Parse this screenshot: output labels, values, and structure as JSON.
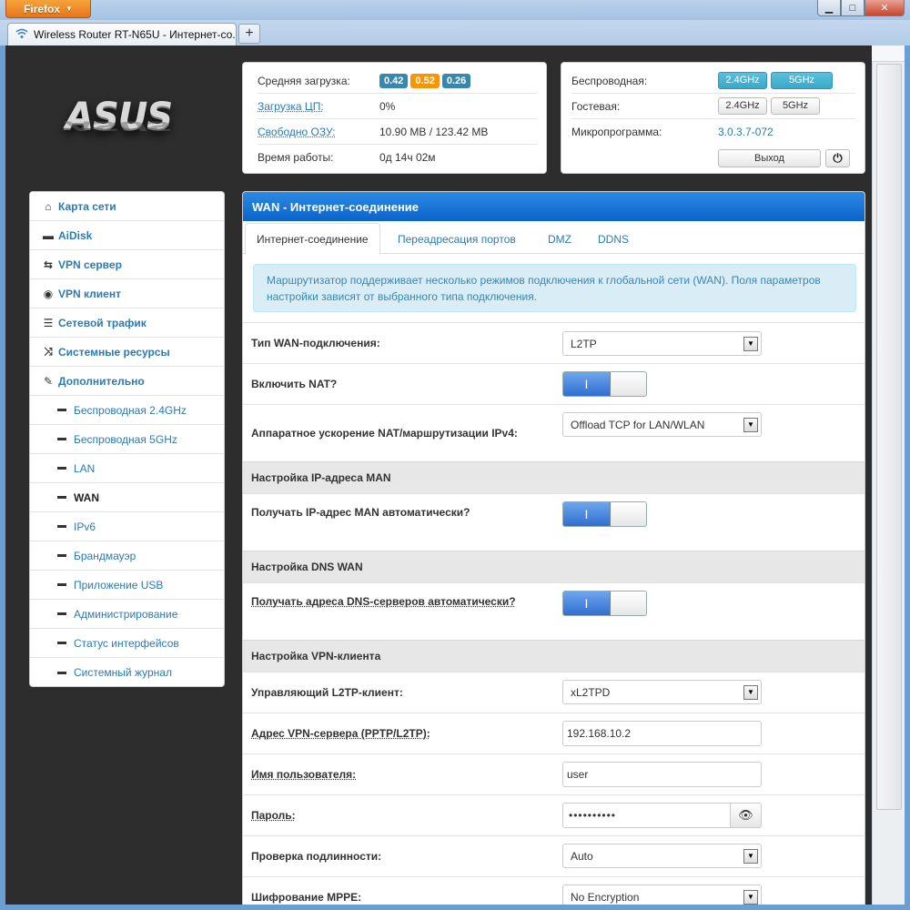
{
  "browser": {
    "app_button": "Firefox",
    "app_button_arrow": "▼",
    "tab_title": "Wireless Router RT-N65U - Интернет-со...",
    "new_tab": "+",
    "minimize": "▁",
    "maximize": "□",
    "close": "✕"
  },
  "logo": {
    "text": "ASUS"
  },
  "status": {
    "load_label": "Средняя загрузка:",
    "load_values": [
      "0.42",
      "0.52",
      "0.26"
    ],
    "cpu_label": "Загрузка ЦП:",
    "cpu_value": "0%",
    "ram_label": "Свободно ОЗУ:",
    "ram_value": "10.90 MB / 123.42 MB",
    "uptime_label": "Время работы:",
    "uptime_value": "0д 14ч 02м"
  },
  "wireless_panel": {
    "wireless_label": "Беспроводная:",
    "guest_label": "Гостевая:",
    "firmware_label": "Микропрограмма:",
    "firmware_value": "3.0.3.7-072",
    "band_24": "2.4GHz",
    "band_5": "5GHz",
    "logout": "Выход",
    "power_icon": "⏻"
  },
  "sidebar": {
    "items": [
      {
        "label": "Карта сети",
        "icon": "home-icon",
        "glyph": "⌂"
      },
      {
        "label": "AiDisk",
        "icon": "hdd-icon",
        "glyph": "▬"
      },
      {
        "label": "VPN сервер",
        "icon": "retweet-icon",
        "glyph": "⇆"
      },
      {
        "label": "VPN клиент",
        "icon": "globe-icon",
        "glyph": "◉"
      },
      {
        "label": "Сетевой трафик",
        "icon": "list-icon",
        "glyph": "☰"
      },
      {
        "label": "Системные ресурсы",
        "icon": "random-icon",
        "glyph": "⤨"
      },
      {
        "label": "Дополнительно",
        "icon": "wrench-icon",
        "glyph": "✎"
      }
    ],
    "subitems": [
      "Беспроводная 2.4GHz",
      "Беспроводная 5GHz",
      "LAN",
      "WAN",
      "IPv6",
      "Брандмауэр",
      "Приложение USB",
      "Администрирование",
      "Статус интерфейсов",
      "Системный журнал"
    ]
  },
  "main": {
    "title": "WAN - Интернет-соединение",
    "tabs": [
      "Интернет-соединение",
      "Переадресация портов",
      "DMZ",
      "DDNS"
    ],
    "info": "Маршрутизатор поддерживает несколько режимов подключения к глобальной сети (WAN). Поля параметров настройки зависят от выбранного типа подключения.",
    "wan_type_label": "Тип WAN-подключения:",
    "wan_type_value": "L2TP",
    "nat_label": "Включить NAT?",
    "hw_accel_label": "Аппаратное ускорение NAT/маршрутизации IPv4:",
    "hw_accel_value": "Offload TCP for LAN/WLAN",
    "man_section": "Настройка IP-адреса MAN",
    "man_auto_label": "Получать IP-адрес MAN автоматически?",
    "dns_section": "Настройка DNS WAN",
    "dns_auto_label": "Получать адреса DNS-серверов автоматически?",
    "vpn_section": "Настройка VPN-клиента",
    "l2tp_client_label": "Управляющий L2TP-клиент:",
    "l2tp_client_value": "xL2TPD",
    "vpn_server_label": "Адрес VPN-сервера (PPTP/L2TP):",
    "vpn_server_value": "192.168.10.2",
    "username_label": "Имя пользователя:",
    "username_value": "user",
    "password_label": "Пароль:",
    "password_value": "••••••••••",
    "auth_label": "Проверка подлинности:",
    "auth_value": "Auto",
    "mppe_label": "Шифрование MPPE:",
    "mppe_value": "No Encryption",
    "toggle_on": "I",
    "select_arrow": "▼",
    "eye_icon": "👁"
  }
}
